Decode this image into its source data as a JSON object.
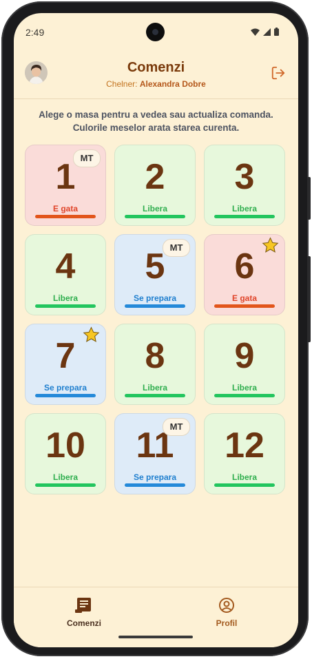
{
  "status_bar": {
    "time": "2:49"
  },
  "header": {
    "title": "Comenzi",
    "waiter_prefix": "Chelner:",
    "waiter_name": "Alexandra Dobre"
  },
  "instructions": {
    "line1": "Alege o masa pentru a vedea sau actualiza comanda.",
    "line2": "Culorile meselor arata starea curenta."
  },
  "status_colors": {
    "ready": "#e2551b",
    "free": "#22c55e",
    "preparing": "#2489d9",
    "title": "#7a3a0b"
  },
  "tables": [
    {
      "number": "1",
      "status": "E gata",
      "badge": "MT",
      "star": false
    },
    {
      "number": "2",
      "status": "Libera",
      "badge": "",
      "star": false
    },
    {
      "number": "3",
      "status": "Libera",
      "badge": "",
      "star": false
    },
    {
      "number": "4",
      "status": "Libera",
      "badge": "",
      "star": false
    },
    {
      "number": "5",
      "status": "Se prepara",
      "badge": "MT",
      "star": false
    },
    {
      "number": "6",
      "status": "E gata",
      "badge": "",
      "star": true
    },
    {
      "number": "7",
      "status": "Se prepara",
      "badge": "",
      "star": true
    },
    {
      "number": "8",
      "status": "Libera",
      "badge": "",
      "star": false
    },
    {
      "number": "9",
      "status": "Libera",
      "badge": "",
      "star": false
    },
    {
      "number": "10",
      "status": "Libera",
      "badge": "",
      "star": false
    },
    {
      "number": "11",
      "status": "Se prepara",
      "badge": "MT",
      "star": false
    },
    {
      "number": "12",
      "status": "Libera",
      "badge": "",
      "star": false
    }
  ],
  "bottom_nav": {
    "items": [
      {
        "label": "Comenzi",
        "icon": "receipt-icon",
        "active": true
      },
      {
        "label": "Profil",
        "icon": "profile-icon",
        "active": false
      }
    ]
  }
}
